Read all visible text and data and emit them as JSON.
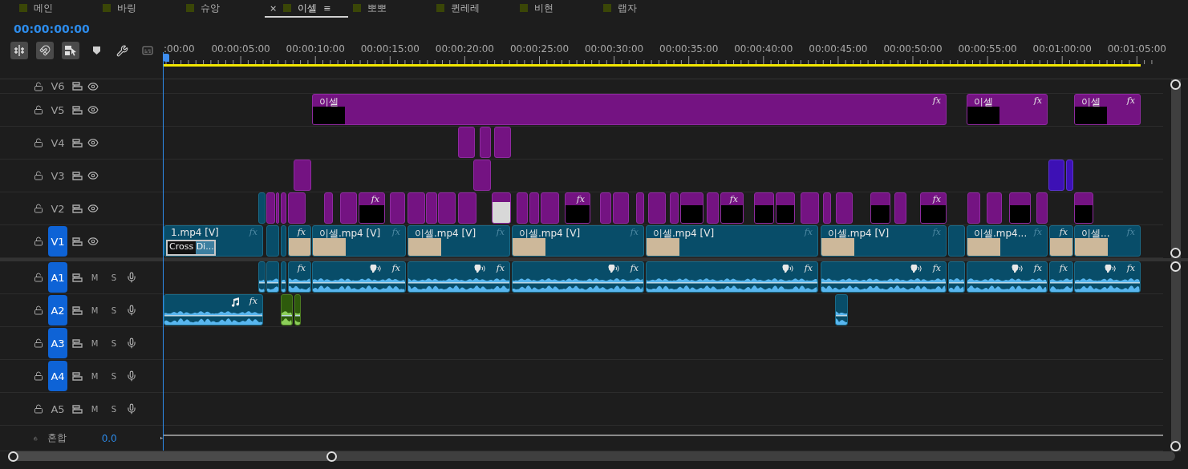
{
  "tabs": [
    {
      "label": "메인",
      "selected": false
    },
    {
      "label": "바링",
      "selected": false
    },
    {
      "label": "슈앙",
      "selected": false
    },
    {
      "label": "이셀",
      "selected": true,
      "close": "×",
      "menu": "≡"
    },
    {
      "label": "뽀뽀",
      "selected": false
    },
    {
      "label": "퀸레레",
      "selected": false
    },
    {
      "label": "비현",
      "selected": false
    },
    {
      "label": "랩자",
      "selected": false
    }
  ],
  "timecode": "00:00:00:00",
  "ruler": {
    "labels": [
      ":00:00",
      "00:00:05:00",
      "00:00:10:00",
      "00:00:15:00",
      "00:00:20:00",
      "00:00:25:00",
      "00:00:30:00",
      "00:00:35:00",
      "00:00:40:00",
      "00:00:45:00",
      "00:00:50:00",
      "00:00:55:00",
      "00:01:00:00",
      "00:01:05:00"
    ]
  },
  "video_tracks": [
    {
      "name": "V6",
      "selected": false
    },
    {
      "name": "V5",
      "selected": false,
      "clips": [
        {
          "kind": "title",
          "label": "이셀",
          "fx": "fx"
        },
        {
          "kind": "title",
          "label": "이셀",
          "fx": "fx"
        },
        {
          "kind": "title",
          "label": "이셀",
          "fx": "fx"
        }
      ]
    },
    {
      "name": "V4",
      "selected": false,
      "clips": [
        {
          "kind": "graphic"
        },
        {
          "kind": "graphic"
        },
        {
          "kind": "graphic"
        }
      ]
    },
    {
      "name": "V3",
      "selected": false,
      "clips": [
        {
          "kind": "graphic"
        },
        {
          "kind": "graphic"
        },
        {
          "kind": "adjust"
        },
        {
          "kind": "adjust"
        }
      ]
    },
    {
      "name": "V2",
      "selected": false,
      "clips": [
        {
          "kind": "video"
        },
        {
          "kind": "graphic"
        },
        {
          "kind": "graphic"
        },
        {
          "kind": "graphic"
        },
        {
          "kind": "graphic"
        },
        {
          "kind": "graphic"
        },
        {
          "kind": "graphic"
        },
        {
          "kind": "thumb",
          "fx": "fx"
        },
        {
          "kind": "graphic"
        },
        {
          "kind": "graphic"
        },
        {
          "kind": "graphic"
        },
        {
          "kind": "graphic"
        },
        {
          "kind": "graphic"
        },
        {
          "kind": "photo"
        },
        {
          "kind": "graphic"
        },
        {
          "kind": "graphic"
        },
        {
          "kind": "graphic"
        },
        {
          "kind": "thumb",
          "fx": "fx"
        },
        {
          "kind": "graphic"
        },
        {
          "kind": "graphic"
        },
        {
          "kind": "graphic"
        },
        {
          "kind": "graphic"
        },
        {
          "kind": "graphic"
        },
        {
          "kind": "thumb"
        },
        {
          "kind": "graphic"
        },
        {
          "kind": "thumb",
          "fx": "fx"
        },
        {
          "kind": "thumb"
        },
        {
          "kind": "thumb"
        },
        {
          "kind": "graphic"
        },
        {
          "kind": "graphic"
        },
        {
          "kind": "graphic"
        },
        {
          "kind": "thumb"
        },
        {
          "kind": "graphic"
        },
        {
          "kind": "thumb",
          "fx": "fx"
        },
        {
          "kind": "graphic"
        },
        {
          "kind": "graphic"
        },
        {
          "kind": "thumb"
        },
        {
          "kind": "graphic"
        },
        {
          "kind": "thumb"
        }
      ]
    },
    {
      "name": "V1",
      "selected": true,
      "clips": [
        {
          "kind": "video",
          "label": "1.mp4 [V]",
          "fx": "fx",
          "transition": "Cross Di..."
        },
        {
          "kind": "video"
        },
        {
          "kind": "video"
        },
        {
          "kind": "video",
          "fx": "fx",
          "thumbnail": true
        },
        {
          "kind": "video",
          "label": "이셀.mp4 [V]",
          "fx": "fx",
          "thumbnail": true
        },
        {
          "kind": "video",
          "label": "이셀.mp4 [V]",
          "fx": "fx",
          "thumbnail": true
        },
        {
          "kind": "video",
          "label": "이셀.mp4 [V]",
          "fx": "fx",
          "thumbnail": true
        },
        {
          "kind": "video",
          "label": "이셀.mp4 [V]",
          "fx": "fx",
          "thumbnail": true
        },
        {
          "kind": "video",
          "label": "이셀.mp4 [V]",
          "fx": "fx",
          "thumbnail": true
        },
        {
          "kind": "video"
        },
        {
          "kind": "video",
          "label": "이셀.mp4...",
          "fx": "fx",
          "thumbnail": true
        },
        {
          "kind": "video",
          "fx": "fx",
          "thumbnail": true
        },
        {
          "kind": "video",
          "label": "이셀...",
          "fx": "fx",
          "thumbnail": true
        }
      ]
    }
  ],
  "audio_tracks": [
    {
      "name": "A1",
      "selected": true,
      "mute": "M",
      "solo": "S",
      "clips": [
        {
          "kind": "audio"
        },
        {
          "kind": "audio"
        },
        {
          "kind": "audio"
        },
        {
          "kind": "audio",
          "fx": "fx"
        },
        {
          "kind": "dialogue",
          "fx": "fx"
        },
        {
          "kind": "dialogue",
          "fx": "fx"
        },
        {
          "kind": "dialogue",
          "fx": "fx"
        },
        {
          "kind": "dialogue",
          "fx": "fx"
        },
        {
          "kind": "dialogue",
          "fx": "fx"
        },
        {
          "kind": "audio"
        },
        {
          "kind": "dialogue",
          "fx": "fx"
        },
        {
          "kind": "audio",
          "fx": "fx"
        },
        {
          "kind": "dialogue",
          "fx": "fx"
        }
      ]
    },
    {
      "name": "A2",
      "selected": true,
      "mute": "M",
      "solo": "S",
      "clips": [
        {
          "kind": "music",
          "fx": "fx"
        },
        {
          "kind": "green"
        },
        {
          "kind": "green"
        },
        {
          "kind": "audio"
        }
      ]
    },
    {
      "name": "A3",
      "selected": true,
      "mute": "M",
      "solo": "S"
    },
    {
      "name": "A4",
      "selected": true,
      "mute": "M",
      "solo": "S"
    },
    {
      "name": "A5",
      "selected": false,
      "mute": "M",
      "solo": "S"
    }
  ],
  "mix": {
    "name": "혼합",
    "value": "0.0"
  }
}
